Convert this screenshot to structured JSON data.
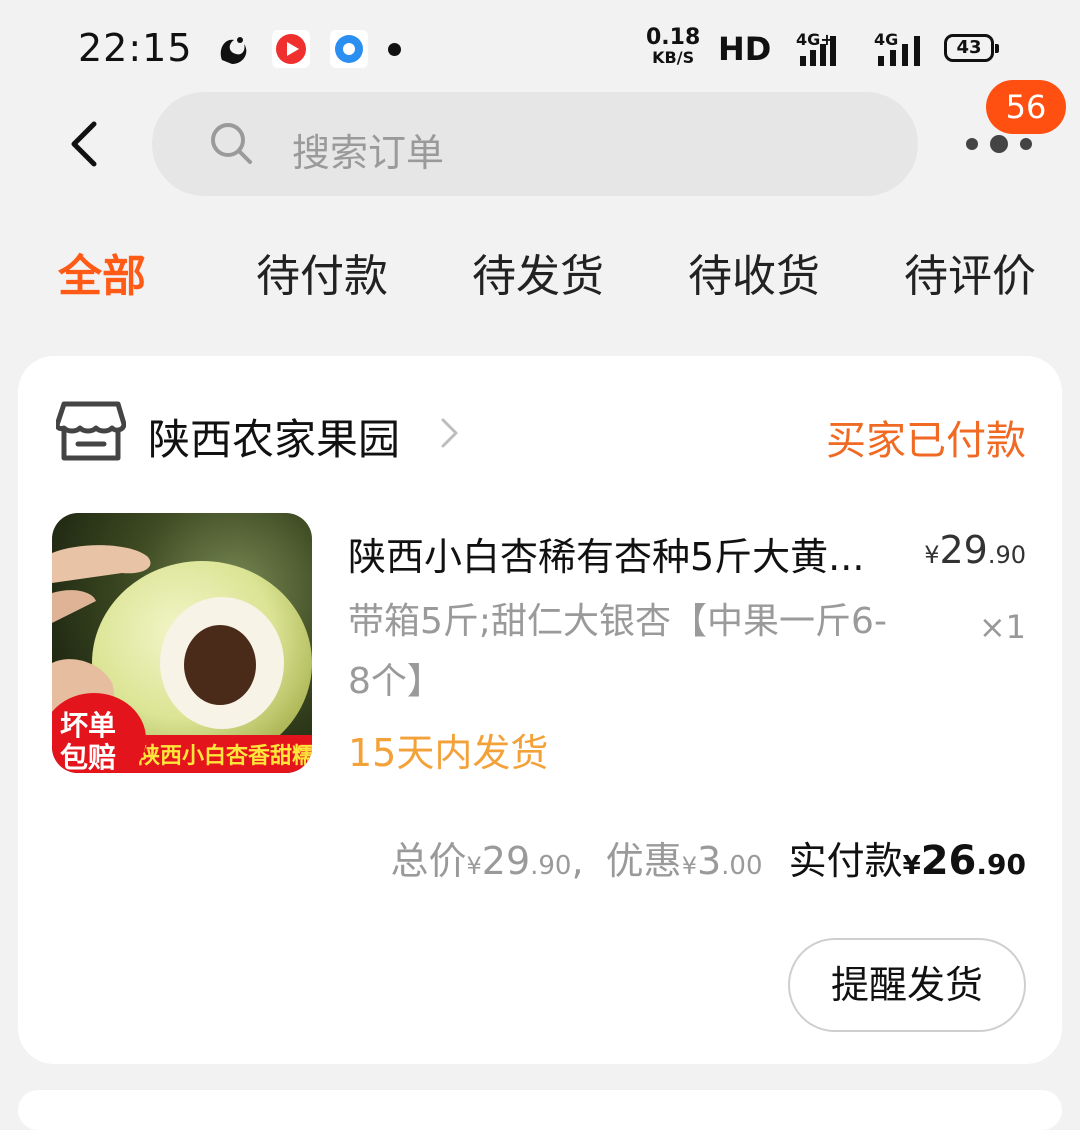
{
  "status_bar": {
    "time": "22:15",
    "net_speed": "0.18",
    "net_unit": "KB/S",
    "hd": "HD",
    "signal1": "4G+",
    "signal2": "4G",
    "battery": "43"
  },
  "header": {
    "search_placeholder": "搜索订单",
    "badge_count": "56"
  },
  "tabs": [
    {
      "label": "全部",
      "active": true
    },
    {
      "label": "待付款",
      "active": false
    },
    {
      "label": "待发货",
      "active": false
    },
    {
      "label": "待收货",
      "active": false
    },
    {
      "label": "待评价",
      "active": false
    }
  ],
  "order": {
    "store_name": "陕西农家果园",
    "status": "买家已付款",
    "thumbnail": {
      "badge_line1": "坏单",
      "badge_line2": "包赔",
      "banner": "陕西小白杏香甜糯"
    },
    "item_title": "陕西小白杏稀有杏种5斤大黄...",
    "price_int": "29",
    "price_dec": ".90",
    "currency": "¥",
    "sku": "带箱5斤;甜仁大银杏【中果一斤6-8个】",
    "quantity": "×1",
    "shipping_note": "15天内发货",
    "totals": {
      "total_label": "总价",
      "total_int": "29",
      "total_dec": ".90",
      "separator": ",",
      "discount_label": "优惠",
      "discount_int": "3",
      "discount_dec": ".00",
      "paid_label": "实付款",
      "paid_int": "26",
      "paid_dec": ".90"
    },
    "action_button": "提醒发货"
  },
  "colors": {
    "accent": "#ff5a16",
    "status_orange": "#f06a24",
    "ship_orange": "#f3a23a",
    "badge": "#ff5012"
  }
}
